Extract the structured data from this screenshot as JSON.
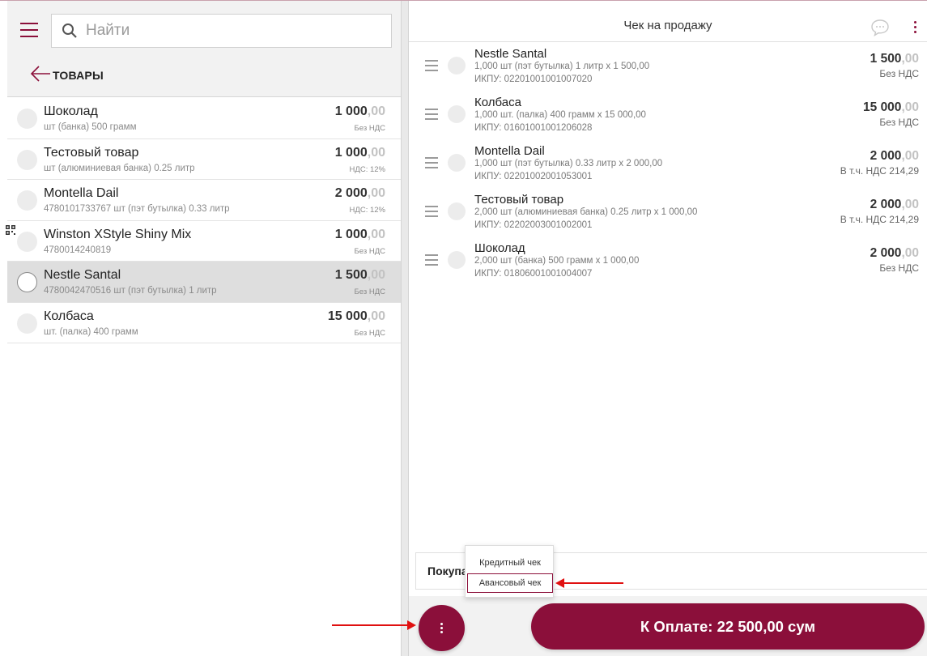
{
  "search": {
    "placeholder": "Найти"
  },
  "category": {
    "title": "ТОВАРЫ"
  },
  "products": [
    {
      "name": "Шоколад",
      "sub": "шт (банка) 500 грамм",
      "price_main": "1 000",
      "price_cents": ",00",
      "tax": "Без НДС",
      "qr": false,
      "selected": false
    },
    {
      "name": "Тестовый товар",
      "sub": "шт (алюминиевая банка) 0.25 литр",
      "price_main": "1 000",
      "price_cents": ",00",
      "tax": "НДС: 12%",
      "qr": false,
      "selected": false
    },
    {
      "name": "Montella Dail",
      "sub": "4780101733767 шт (пэт бутылка) 0.33 литр",
      "price_main": "2 000",
      "price_cents": ",00",
      "tax": "НДС: 12%",
      "qr": false,
      "selected": false
    },
    {
      "name": "Winston XStyle Shiny Mix",
      "sub": "4780014240819",
      "price_main": "1 000",
      "price_cents": ",00",
      "tax": "Без НДС",
      "qr": true,
      "selected": false
    },
    {
      "name": "Nestle Santal",
      "sub": "4780042470516 шт (пэт бутылка) 1 литр",
      "price_main": "1 500",
      "price_cents": ",00",
      "tax": "Без НДС",
      "qr": false,
      "selected": true
    },
    {
      "name": "Колбаса",
      "sub": "шт. (палка) 400 грамм",
      "price_main": "15 000",
      "price_cents": ",00",
      "tax": "Без НДС",
      "qr": false,
      "selected": false
    }
  ],
  "receipt": {
    "title": "Чек на продажу"
  },
  "cart": [
    {
      "name": "Nestle Santal",
      "qty": "1,000 шт (пэт бутылка) 1 литр x 1 500,00",
      "code": "ИКПУ: 02201001001007020",
      "price_main": "1 500",
      "price_cents": ",00",
      "tax": "Без НДС"
    },
    {
      "name": "Колбаса",
      "qty": "1,000 шт. (палка) 400 грамм x 15 000,00",
      "code": "ИКПУ: 01601001001206028",
      "price_main": "15 000",
      "price_cents": ",00",
      "tax": "Без НДС"
    },
    {
      "name": "Montella Dail",
      "qty": "1,000 шт (пэт бутылка) 0.33 литр x 2 000,00",
      "code": "ИКПУ: 02201002001053001",
      "price_main": "2 000",
      "price_cents": ",00",
      "tax": "В т.ч. НДС 214,29"
    },
    {
      "name": "Тестовый товар",
      "qty": "2,000 шт (алюминиевая банка) 0.25 литр x 1 000,00",
      "code": "ИКПУ: 02202003001002001",
      "price_main": "2 000",
      "price_cents": ",00",
      "tax": "В т.ч. НДС 214,29"
    },
    {
      "name": "Шоколад",
      "qty": "2,000 шт (банка) 500 грамм x 1 000,00",
      "code": "ИКПУ: 01806001001004007",
      "price_main": "2 000",
      "price_cents": ",00",
      "tax": "Без НДС"
    }
  ],
  "buyer": {
    "label": "Покупа"
  },
  "popup": {
    "items": [
      "Кредитный чек",
      "Авансовый чек"
    ]
  },
  "pay": {
    "label": "К Оплате: 22 500,00 сум"
  },
  "colors": {
    "accent": "#8b0f3a",
    "arrow": "#e01010",
    "selected_row": "#dedede",
    "panel_bg": "#f2f2f2"
  },
  "icons": [
    "menu-icon",
    "search-icon",
    "arrow-left-icon",
    "qr-code-icon",
    "chat-icon",
    "more-vertical-icon",
    "drag-handle-icon"
  ]
}
